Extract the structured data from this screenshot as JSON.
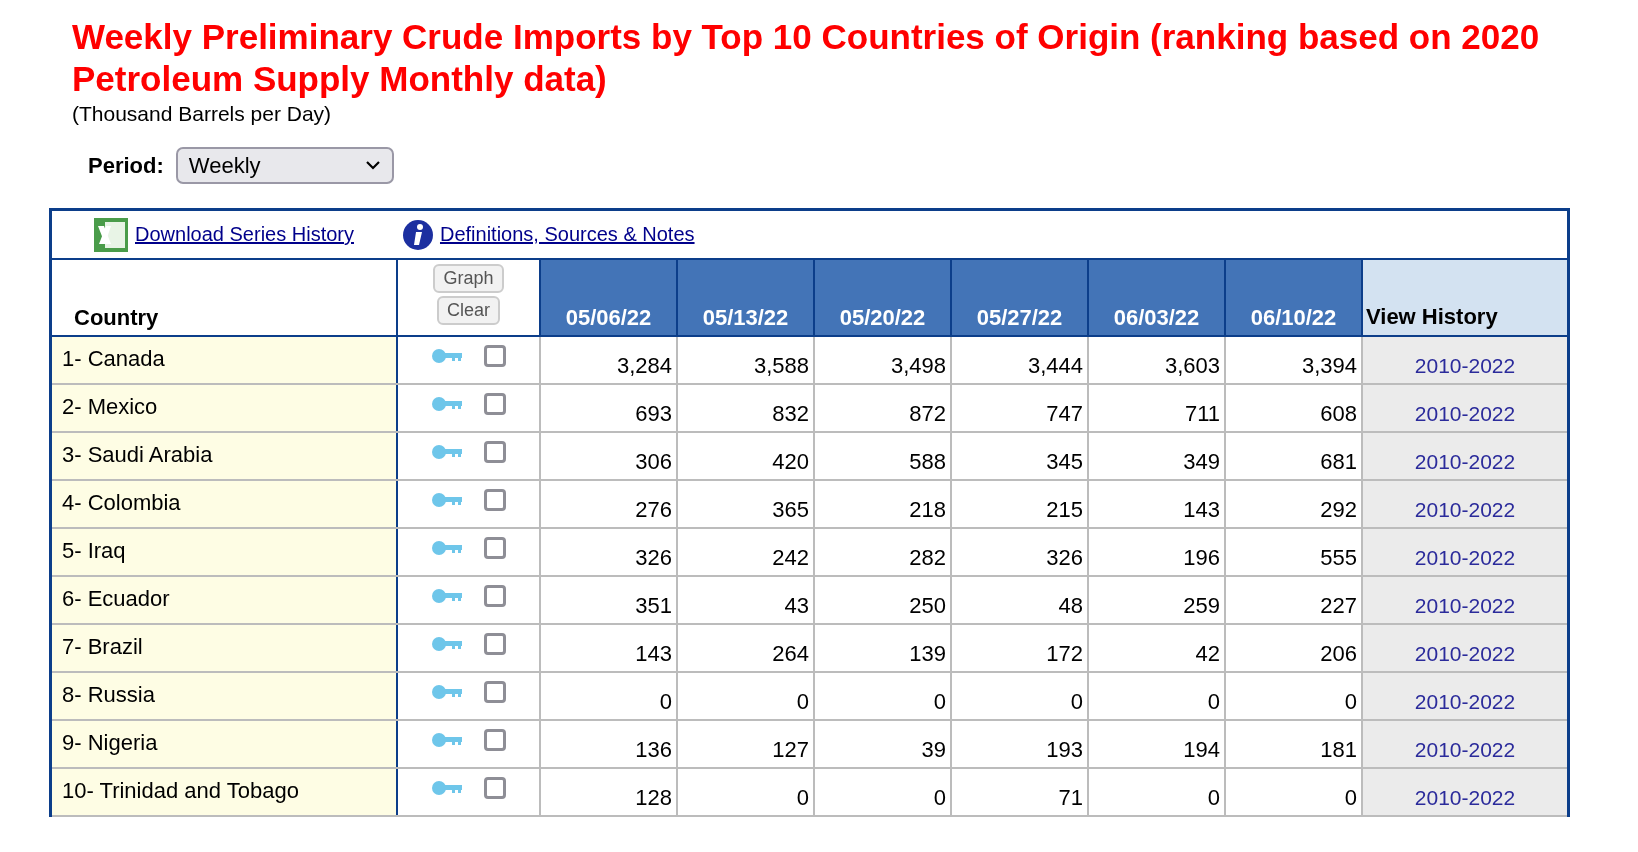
{
  "title": "Weekly Preliminary Crude Imports by Top 10 Countries of Origin (ranking based on 2020 Petroleum Supply Monthly data)",
  "subtitle": "(Thousand Barrels per Day)",
  "period": {
    "label": "Period:",
    "value": "Weekly"
  },
  "links": [
    {
      "kind": "excel",
      "label": "Download Series History"
    },
    {
      "kind": "info",
      "label": "Definitions, Sources & Notes"
    }
  ],
  "table": {
    "columns": {
      "country": "Country",
      "buttons": [
        "Graph",
        "Clear"
      ],
      "dates": [
        "05/06/22",
        "05/13/22",
        "05/20/22",
        "05/27/22",
        "06/03/22",
        "06/10/22"
      ],
      "history": "View History"
    },
    "rows": [
      {
        "country": "1- Canada",
        "checked": false,
        "values": [
          "3,284",
          "3,588",
          "3,498",
          "3,444",
          "3,603",
          "3,394"
        ],
        "history": "2010-2022"
      },
      {
        "country": "2- Mexico",
        "checked": false,
        "values": [
          "693",
          "832",
          "872",
          "747",
          "711",
          "608"
        ],
        "history": "2010-2022"
      },
      {
        "country": "3- Saudi Arabia",
        "checked": false,
        "values": [
          "306",
          "420",
          "588",
          "345",
          "349",
          "681"
        ],
        "history": "2010-2022"
      },
      {
        "country": "4- Colombia",
        "checked": false,
        "values": [
          "276",
          "365",
          "218",
          "215",
          "143",
          "292"
        ],
        "history": "2010-2022"
      },
      {
        "country": "5- Iraq",
        "checked": false,
        "values": [
          "326",
          "242",
          "282",
          "326",
          "196",
          "555"
        ],
        "history": "2010-2022"
      },
      {
        "country": "6- Ecuador",
        "checked": false,
        "values": [
          "351",
          "43",
          "250",
          "48",
          "259",
          "227"
        ],
        "history": "2010-2022"
      },
      {
        "country": "7- Brazil",
        "checked": false,
        "values": [
          "143",
          "264",
          "139",
          "172",
          "42",
          "206"
        ],
        "history": "2010-2022"
      },
      {
        "country": "8- Russia",
        "checked": false,
        "values": [
          "0",
          "0",
          "0",
          "0",
          "0",
          "0"
        ],
        "history": "2010-2022"
      },
      {
        "country": "9- Nigeria",
        "checked": false,
        "values": [
          "136",
          "127",
          "39",
          "193",
          "194",
          "181"
        ],
        "history": "2010-2022"
      },
      {
        "country": "10- Trinidad and Tobago",
        "checked": false,
        "values": [
          "128",
          "0",
          "0",
          "71",
          "0",
          "0"
        ],
        "history": "2010-2022"
      }
    ]
  }
}
